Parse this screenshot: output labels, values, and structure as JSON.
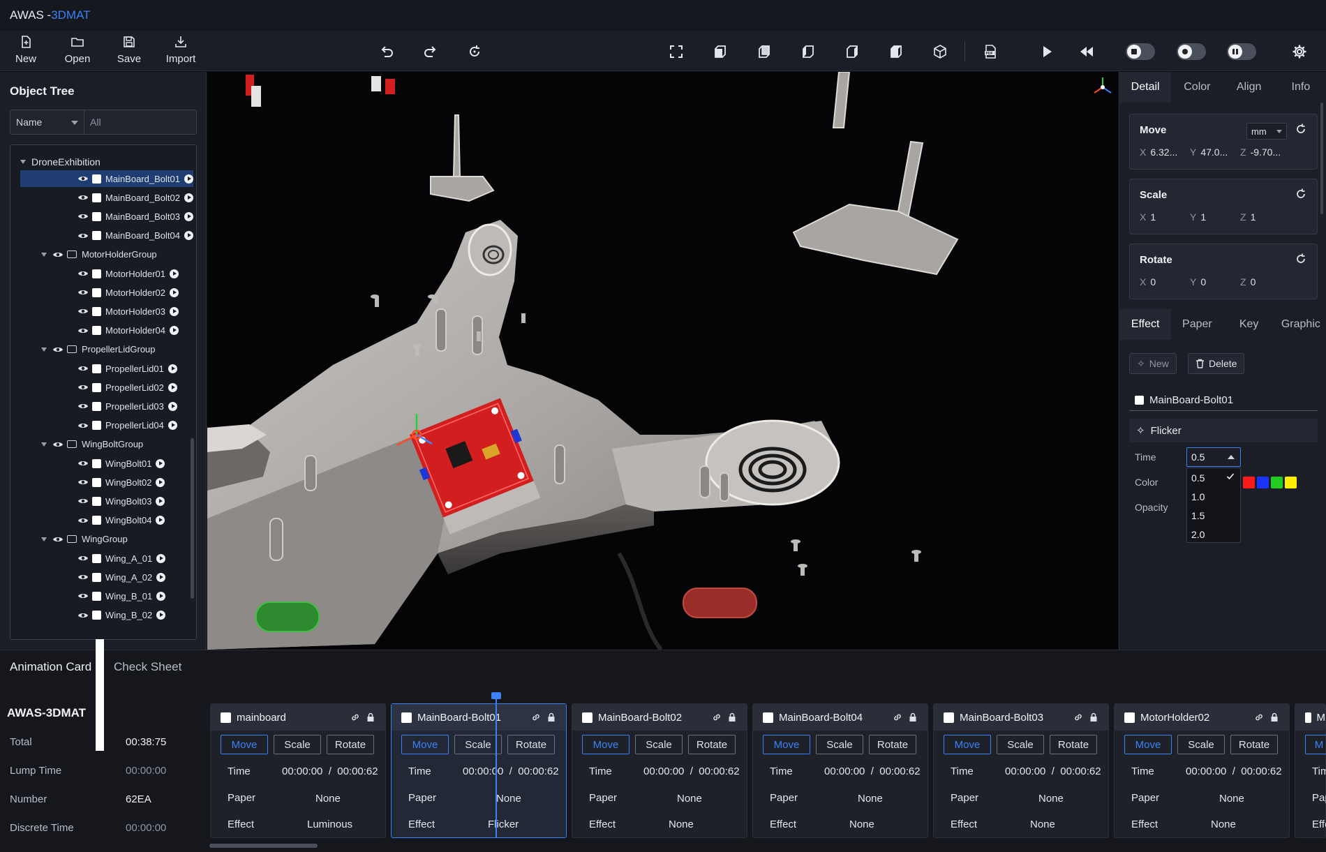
{
  "app": {
    "title_main": "AWAS - ",
    "title_accent": "3DMAT"
  },
  "toolbar": {
    "new_label": "New",
    "open_label": "Open",
    "save_label": "Save",
    "import_label": "Import",
    "toggles": [
      {
        "icon": "stop-icon",
        "on": false
      },
      {
        "icon": "record-icon",
        "on": false
      },
      {
        "icon": "pause-icon",
        "on": false
      }
    ]
  },
  "tree": {
    "title": "Object Tree",
    "filter_field": "Name",
    "filter_value": "All",
    "root": "DroneExhibition",
    "items": [
      {
        "label": "MainBoard_Bolt01",
        "type": "item",
        "selected": true
      },
      {
        "label": "MainBoard_Bolt02",
        "type": "item"
      },
      {
        "label": "MainBoard_Bolt03",
        "type": "item"
      },
      {
        "label": "MainBoard_Bolt04",
        "type": "item"
      },
      {
        "label": "MotorHolderGroup",
        "type": "group"
      },
      {
        "label": "MotorHolder01",
        "type": "item"
      },
      {
        "label": "MotorHolder02",
        "type": "item"
      },
      {
        "label": "MotorHolder03",
        "type": "item"
      },
      {
        "label": "MotorHolder04",
        "type": "item"
      },
      {
        "label": "PropellerLidGroup",
        "type": "group"
      },
      {
        "label": "PropellerLid01",
        "type": "item"
      },
      {
        "label": "PropellerLid02",
        "type": "item"
      },
      {
        "label": "PropellerLid03",
        "type": "item"
      },
      {
        "label": "PropellerLid04",
        "type": "item"
      },
      {
        "label": "WingBoltGroup",
        "type": "group"
      },
      {
        "label": "WingBolt01",
        "type": "item"
      },
      {
        "label": "WingBolt02",
        "type": "item"
      },
      {
        "label": "WingBolt03",
        "type": "item"
      },
      {
        "label": "WingBolt04",
        "type": "item"
      },
      {
        "label": "WingGroup",
        "type": "group"
      },
      {
        "label": "Wing_A_01",
        "type": "item"
      },
      {
        "label": "Wing_A_02",
        "type": "item"
      },
      {
        "label": "Wing_B_01",
        "type": "item"
      },
      {
        "label": "Wing_B_02",
        "type": "item"
      }
    ]
  },
  "right": {
    "tabs": [
      "Detail",
      "Color",
      "Align",
      "Info"
    ],
    "move": {
      "title": "Move",
      "unit": "mm",
      "x": "6.32...",
      "y": "47.0...",
      "z": "-9.70..."
    },
    "scale": {
      "title": "Scale",
      "x": "1",
      "y": "1",
      "z": "1"
    },
    "rotate": {
      "title": "Rotate",
      "x": "0",
      "y": "0",
      "z": "0"
    },
    "axis_x": "X",
    "axis_y": "Y",
    "axis_z": "Z",
    "tabs2": [
      "Effect",
      "Paper",
      "Key",
      "Graphic"
    ],
    "new_label": "New",
    "delete_label": "Delete",
    "effect_item": "MainBoard-Bolt01",
    "effect_name": "Flicker",
    "time_label": "Time",
    "color_label": "Color",
    "opacity_label": "Opacity",
    "time_value": "0.5",
    "time_options": [
      "0.5",
      "1.0",
      "1.5",
      "2.0"
    ],
    "swatches": [
      "#ff1a1a",
      "#1a33ff",
      "#22cc22",
      "#ffee00"
    ]
  },
  "bottom": {
    "tab_anim": "Animation Card",
    "tab_check": "Check Sheet",
    "summary_title": "AWAS-3DMAT",
    "summary": [
      {
        "label": "Total",
        "value": "00:38:75"
      },
      {
        "label": "Lump Time",
        "value": "00:00:00"
      },
      {
        "label": "Number",
        "value": "62EA"
      },
      {
        "label": "Discrete Time",
        "value": "00:00:00"
      }
    ],
    "labels": {
      "move": "Move",
      "scale": "Scale",
      "rotate": "Rotate",
      "time": "Time",
      "paper": "Paper",
      "effect": "Effect"
    },
    "cards": [
      {
        "name": "mainboard",
        "time": "00:00:00  /  00:00:62",
        "paper": "None",
        "effect": "Luminous"
      },
      {
        "name": "MainBoard-Bolt01",
        "time": "00:00:00  /  00:00:62",
        "paper": "None",
        "effect": "Flicker",
        "active": true
      },
      {
        "name": "MainBoard-Bolt02",
        "time": "00:00:00  /  00:00:62",
        "paper": "None",
        "effect": "None"
      },
      {
        "name": "MainBoard-Bolt04",
        "time": "00:00:00  /  00:00:62",
        "paper": "None",
        "effect": "None"
      },
      {
        "name": "MainBoard-Bolt03",
        "time": "00:00:00  /  00:00:62",
        "paper": "None",
        "effect": "None"
      },
      {
        "name": "MotorHolder02",
        "time": "00:00:00  /  00:00:62",
        "paper": "None",
        "effect": "None"
      }
    ],
    "partial_card": {
      "name": "M",
      "move": "M",
      "time": "Tim",
      "paper": "Pap",
      "effect": "Effe"
    }
  }
}
